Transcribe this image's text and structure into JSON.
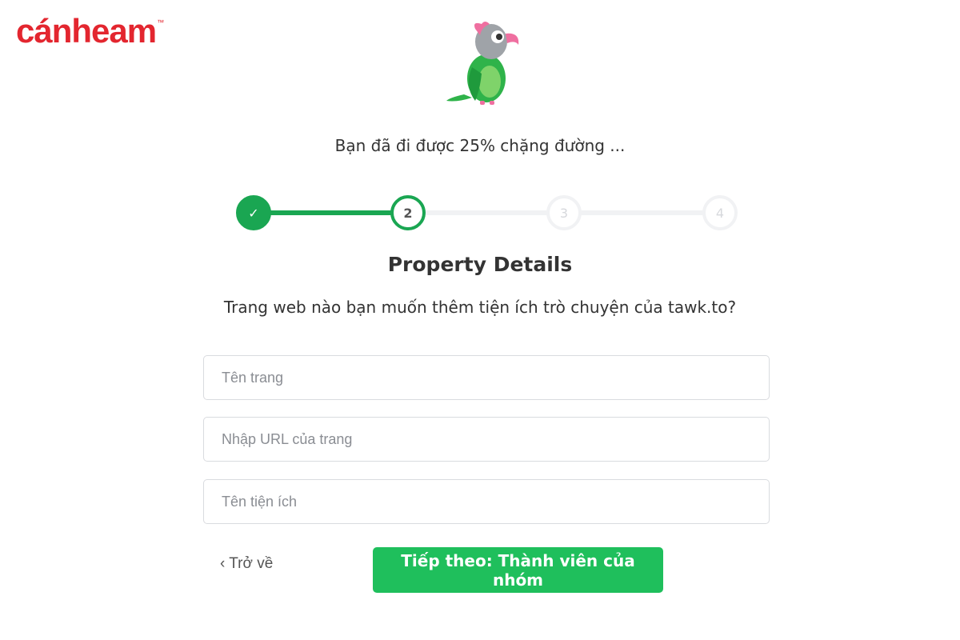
{
  "brand": {
    "logo_text": "cánheam",
    "trademark": "™",
    "color": "#e3262f"
  },
  "mascot": {
    "icon": "parrot-mascot-icon"
  },
  "progress": {
    "message": "Bạn đã đi được 25% chặng đường ...",
    "percent": 25,
    "current_step": 2,
    "steps": [
      {
        "label": "✓",
        "state": "done"
      },
      {
        "label": "2",
        "state": "current"
      },
      {
        "label": "3",
        "state": "todo"
      },
      {
        "label": "4",
        "state": "todo"
      }
    ],
    "accent_color": "#1aa652"
  },
  "form": {
    "title": "Property Details",
    "question": "Trang web nào bạn muốn thêm tiện ích trò chuyện của tawk.to?",
    "fields": [
      {
        "placeholder": "Tên trang",
        "value": ""
      },
      {
        "placeholder": "Nhập URL của trang",
        "value": ""
      },
      {
        "placeholder": "Tên tiện ích",
        "value": ""
      }
    ],
    "back_label": "‹ Trở về",
    "next_label": "Tiếp theo: Thành viên của nhóm",
    "button_color": "#1fbf5c"
  }
}
